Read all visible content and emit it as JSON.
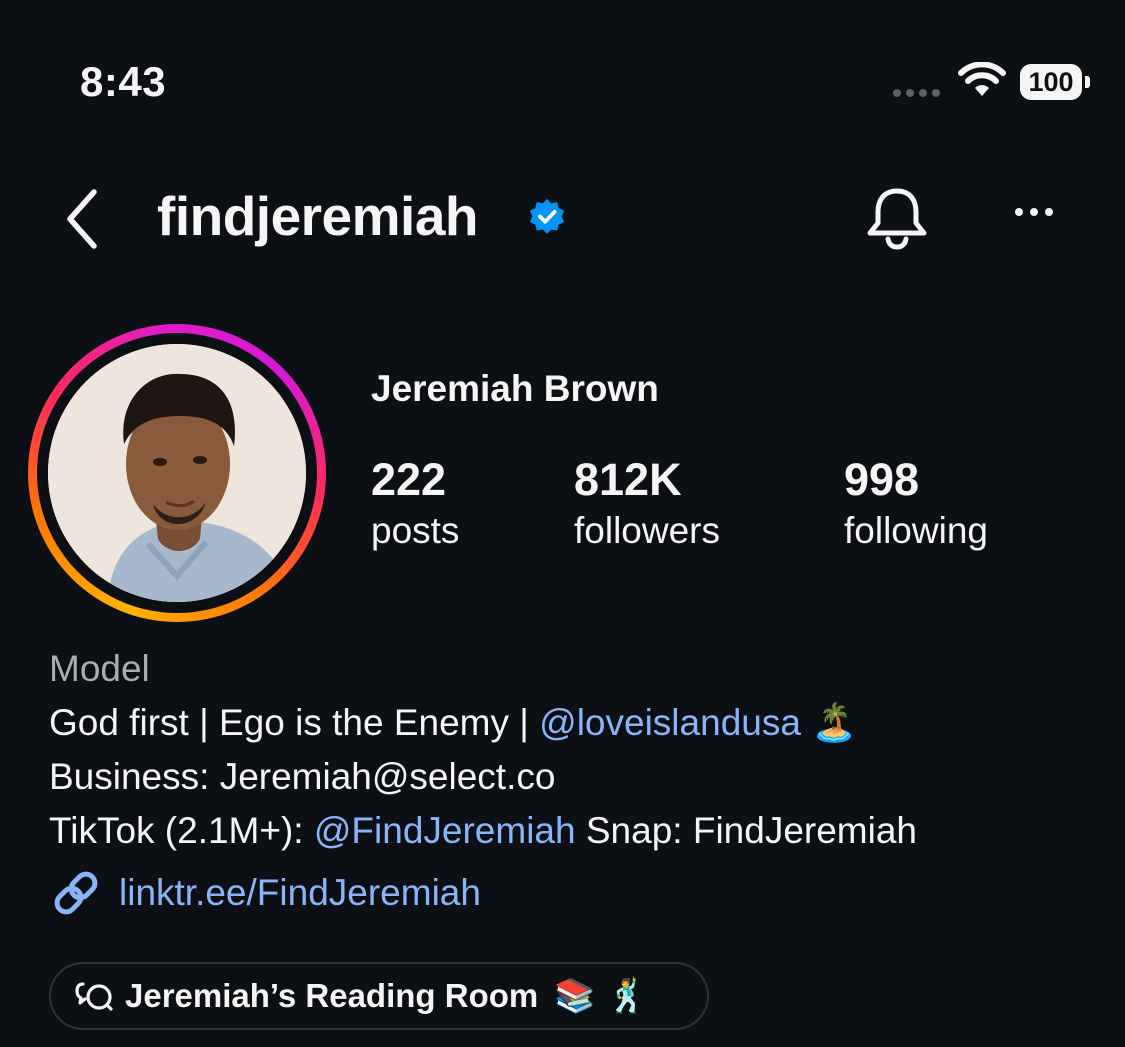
{
  "status_bar": {
    "time": "8:43",
    "battery": "100"
  },
  "header": {
    "username": "findjeremiah",
    "verified_icon": "verified-badge-icon",
    "back_icon": "chevron-left-icon",
    "bell_icon": "bell-icon",
    "more_icon": "more-horizontal-icon"
  },
  "profile": {
    "display_name": "Jeremiah Brown",
    "stats": [
      {
        "value": "222",
        "label": "posts"
      },
      {
        "value": "812K",
        "label": "followers"
      },
      {
        "value": "998",
        "label": "following"
      }
    ],
    "category": "Model",
    "bio": {
      "line1_pre": "God first | Ego is the Enemy | ",
      "line1_mention": "@loveislandusa",
      "line1_emoji": "🏝️",
      "line2": "Business: Jeremiah@select.co",
      "line3_pre": "TikTok (2.1M+): ",
      "line3_mention": "@FindJeremiah",
      "line3_post": " Snap: FindJeremiah"
    },
    "link": "linktr.ee/FindJeremiah",
    "channel": {
      "label": "Jeremiah’s Reading Room",
      "emojis": "📚 🕺"
    }
  },
  "colors": {
    "background": "#0c1014",
    "link": "#8ab4f8",
    "verified": "#0095f6"
  }
}
